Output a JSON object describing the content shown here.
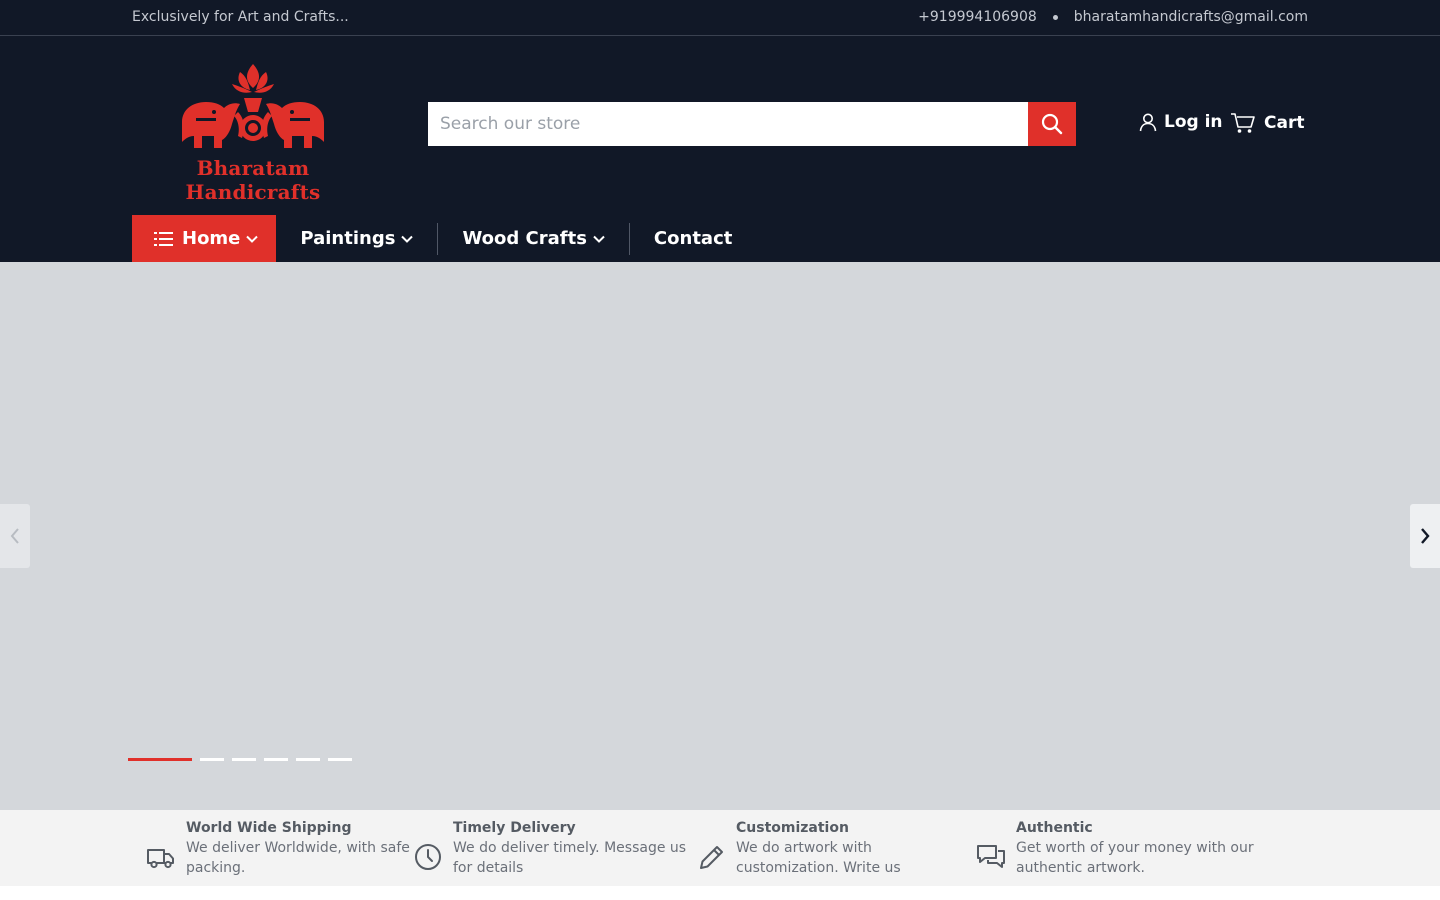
{
  "topbar": {
    "tagline": "Exclusively for Art and Crafts...",
    "phone": "+919994106908",
    "email": "bharatamhandicrafts@gmail.com"
  },
  "header": {
    "logo_text": "Bharatam Handicrafts",
    "search": {
      "placeholder": "Search our store",
      "icon": "search-icon"
    },
    "account_label": "Log in",
    "cart_label": "Cart"
  },
  "nav": {
    "items": [
      {
        "label": "Home",
        "icon": "list-icon",
        "has_dropdown": true,
        "active": true
      },
      {
        "label": "Paintings",
        "has_dropdown": true
      },
      {
        "label": "Wood Crafts",
        "has_dropdown": true
      },
      {
        "label": "Contact",
        "has_dropdown": false
      }
    ]
  },
  "slider": {
    "slide_count": 6,
    "active_index": 0
  },
  "features": [
    {
      "icon": "truck-icon",
      "title": "World Wide Shipping",
      "desc_1": "We deliver Worldwide, with safe",
      "desc_2": "packing."
    },
    {
      "icon": "clock-icon",
      "title": "Timely Delivery",
      "desc_1": "We do deliver timely. Message us",
      "desc_2": "for details"
    },
    {
      "icon": "pencil-icon",
      "title": "Customization",
      "desc_1": "We do artwork with",
      "desc_2": "customization. Write us"
    },
    {
      "icon": "chat-icon",
      "title": "Authentic",
      "desc_1": "Get worth of your money with our",
      "desc_2": "authentic artwork."
    }
  ],
  "colors": {
    "header_bg": "#111827",
    "accent": "#e0302a",
    "hero_bg": "#d4d7db",
    "features_bg": "#f3f3f3"
  }
}
